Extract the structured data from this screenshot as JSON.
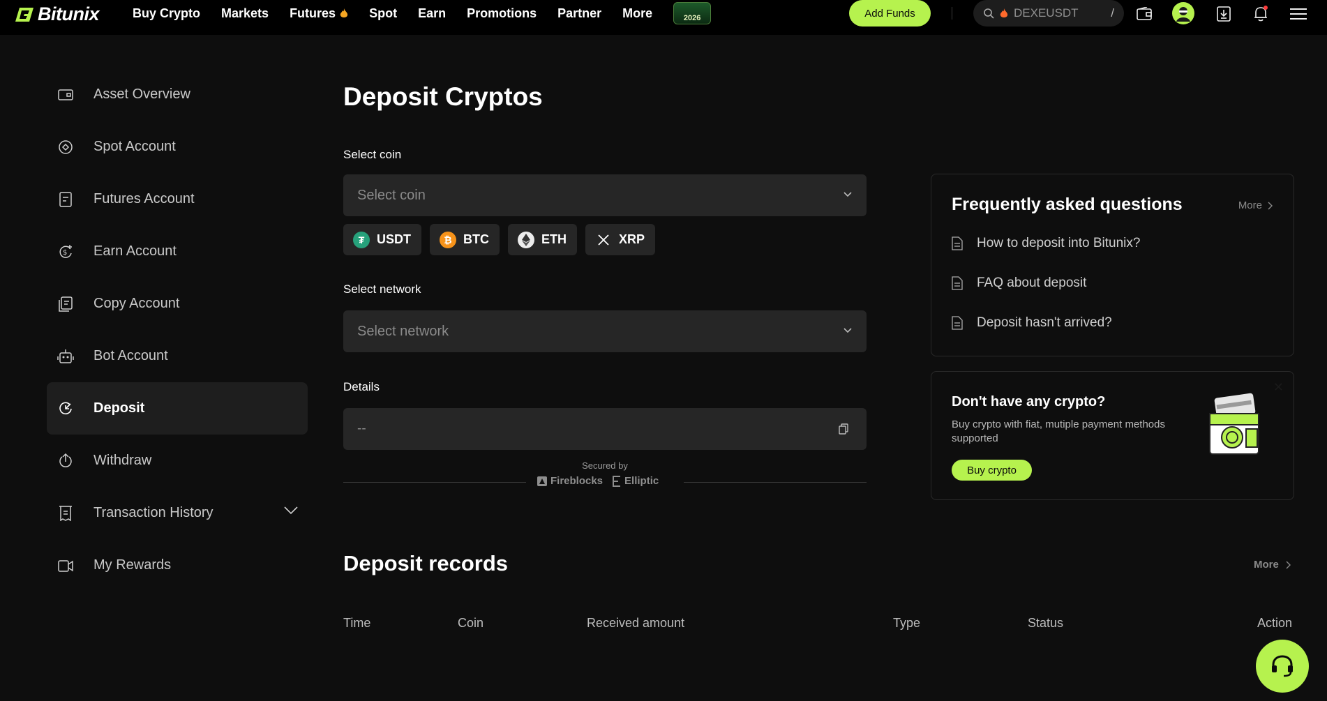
{
  "brand": {
    "name": "Bitunix",
    "accent": "#b6f24e"
  },
  "nav": {
    "items": [
      "Buy Crypto",
      "Markets",
      "Futures",
      "Spot",
      "Earn",
      "Promotions",
      "Partner",
      "More"
    ],
    "badge": "2026"
  },
  "header": {
    "add_funds": "Add Funds",
    "search_value": "DEXEUSDT",
    "search_shortcut": "/",
    "icons": [
      "wallet-icon",
      "avatar",
      "download-icon",
      "bell-icon",
      "menu-icon"
    ]
  },
  "sidebar": {
    "items": [
      {
        "label": "Asset Overview",
        "icon": "wallet-icon"
      },
      {
        "label": "Spot Account",
        "icon": "spot-icon"
      },
      {
        "label": "Futures Account",
        "icon": "futures-icon"
      },
      {
        "label": "Earn Account",
        "icon": "earn-icon"
      },
      {
        "label": "Copy Account",
        "icon": "copy-icon"
      },
      {
        "label": "Bot Account",
        "icon": "bot-icon"
      },
      {
        "label": "Deposit",
        "icon": "deposit-icon",
        "active": true
      },
      {
        "label": "Withdraw",
        "icon": "withdraw-icon"
      },
      {
        "label": "Transaction History",
        "icon": "history-icon"
      },
      {
        "label": "My Rewards",
        "icon": "rewards-icon"
      }
    ]
  },
  "main": {
    "title": "Deposit Cryptos",
    "coin_label": "Select coin",
    "coin_placeholder": "Select coin",
    "coins": [
      {
        "symbol": "USDT",
        "color": "#26a17b"
      },
      {
        "symbol": "BTC",
        "color": "#f7931a"
      },
      {
        "symbol": "ETH",
        "color": "#ececec"
      },
      {
        "symbol": "XRP",
        "color": "#262626"
      }
    ],
    "network_label": "Select network",
    "network_placeholder": "Select network",
    "details_label": "Details",
    "details_value": "--",
    "secured_by": "Secured by",
    "partners": [
      "Fireblocks",
      "Elliptic"
    ]
  },
  "faq": {
    "title": "Frequently asked questions",
    "more": "More",
    "items": [
      "How to deposit into Bitunix?",
      "FAQ about deposit",
      "Deposit hasn't arrived?"
    ]
  },
  "buy_card": {
    "title": "Don't have any crypto?",
    "description": "Buy crypto with fiat, mutiple payment methods supported",
    "button": "Buy crypto"
  },
  "records": {
    "title": "Deposit records",
    "more": "More",
    "columns": [
      "Time",
      "Coin",
      "Received amount",
      "Type",
      "Status",
      "Action"
    ]
  }
}
